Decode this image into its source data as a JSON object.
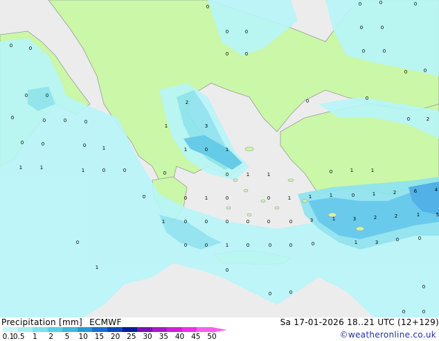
{
  "legend": {
    "title": "Precipitation [mm]",
    "model": "ECMWF",
    "valid": "Sa 17-01-2026 18..21 UTC (12+129)",
    "credit": "©weatheronline.co.uk",
    "ticks": [
      "0.1",
      "0.5",
      "1",
      "2",
      "5",
      "10",
      "15",
      "20",
      "25",
      "30",
      "35",
      "40",
      "45",
      "50"
    ],
    "colors": [
      "#c8f8f8",
      "#a0f0f0",
      "#78e4ec",
      "#58d0e8",
      "#40b8e0",
      "#2898d8",
      "#1870d0",
      "#0c48b8",
      "#061c98",
      "#7a10b0",
      "#a818c8",
      "#d020d8",
      "#f030e8",
      "#f860f0"
    ]
  },
  "map": {
    "colors": {
      "land": "#caf7a8",
      "sea_no_rain": "#ececec",
      "rain_light": "#b8f5f8",
      "rain_med": "#8ee4f0",
      "rain_heavy": "#5ec8ec",
      "rain_strong": "#46ace6",
      "border": "#9a9a9a"
    },
    "labels": [
      "0",
      "1",
      "2",
      "3",
      "4",
      "5",
      "6",
      "8"
    ]
  }
}
